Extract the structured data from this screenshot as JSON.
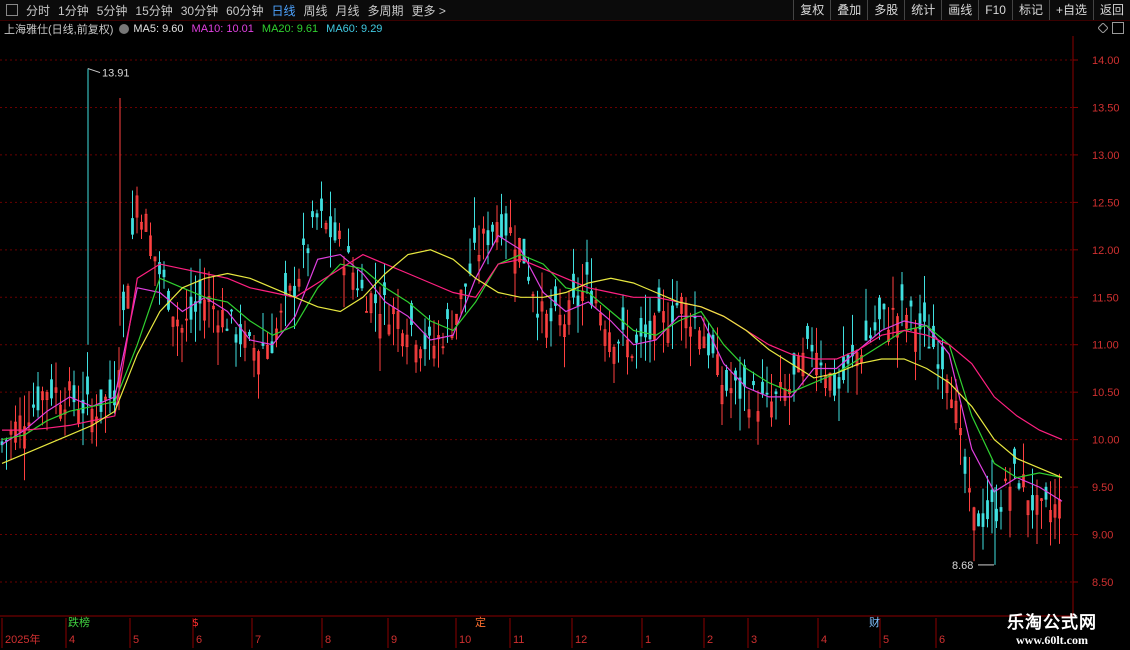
{
  "toolbar": {
    "periods": [
      "分时",
      "1分钟",
      "5分钟",
      "15分钟",
      "30分钟",
      "60分钟",
      "日线",
      "周线",
      "月线",
      "多周期",
      "更多 >"
    ],
    "active_period": "日线",
    "buttons": [
      "复权",
      "叠加",
      "多股",
      "统计",
      "画线",
      "F10",
      "标记",
      "+自选",
      "返回"
    ]
  },
  "info": {
    "stock": "上海雅仕(日线,前复权)",
    "ma": [
      {
        "label": "MA5: 9.60",
        "color": "#e0e0e0"
      },
      {
        "label": "MA10: 10.01",
        "color": "#e040e0"
      },
      {
        "label": "MA20: 9.61",
        "color": "#30d030"
      },
      {
        "label": "MA60: 9.29",
        "color": "#40c8e0"
      }
    ]
  },
  "chart_data": {
    "type": "candlestick",
    "ylim": [
      8.5,
      14.0
    ],
    "yticks": [
      "14.00",
      "13.50",
      "13.00",
      "12.50",
      "12.00",
      "11.50",
      "11.00",
      "10.50",
      "10.00",
      "9.50",
      "9.00",
      "8.50"
    ],
    "grid": true,
    "high_label": "13.91",
    "low_label": "8.68",
    "x_labels": [
      "2025年",
      "4",
      "5",
      "6",
      "7",
      "8",
      "9",
      "10",
      "11",
      "12",
      "1",
      "2",
      "3",
      "4",
      "5",
      "6"
    ],
    "events": [
      {
        "label": "跌榜",
        "color": "#40d040"
      },
      {
        "label": "$",
        "color": "#ff3030"
      },
      {
        "label": "定",
        "color": "#ff7030"
      },
      {
        "label": "财",
        "color": "#80c0ff"
      }
    ],
    "series": [
      {
        "color": "#ffffff",
        "values": [
          9.95,
          10.25,
          10.55,
          10.45,
          10.3,
          10.5,
          12.6,
          11.75,
          11.15,
          11.5,
          11.25,
          10.95,
          11.05,
          11.65,
          12.35,
          12.05,
          11.55,
          11.4,
          11.25,
          10.95,
          11.25,
          11.95,
          12.35,
          12.05,
          11.25,
          11.25,
          11.65,
          11.15,
          10.95,
          11.15,
          11.45,
          11.2,
          10.55,
          10.5,
          10.35,
          10.55,
          11.05,
          10.5,
          10.95,
          11.25,
          11.35,
          11.1,
          10.75,
          9.15,
          9.25,
          9.65,
          9.2,
          9.3
        ]
      },
      {
        "color": "#e040e0",
        "values": [
          9.95,
          10.1,
          10.3,
          10.45,
          10.35,
          10.45,
          11.6,
          11.55,
          11.35,
          11.5,
          11.35,
          11.05,
          11.0,
          11.3,
          11.9,
          11.95,
          11.75,
          11.45,
          11.3,
          11.05,
          11.1,
          11.7,
          12.15,
          12.0,
          11.55,
          11.35,
          11.45,
          11.25,
          11.0,
          11.05,
          11.3,
          11.3,
          10.8,
          10.55,
          10.45,
          10.45,
          10.75,
          10.75,
          10.95,
          11.15,
          11.25,
          11.2,
          10.9,
          9.9,
          9.45,
          9.6,
          9.5,
          9.35
        ]
      },
      {
        "color": "#30d030",
        "values": [
          10.0,
          10.05,
          10.2,
          10.3,
          10.35,
          10.4,
          11.0,
          11.7,
          11.6,
          11.5,
          11.45,
          11.25,
          11.1,
          11.2,
          11.6,
          11.85,
          11.8,
          11.6,
          11.45,
          11.25,
          11.15,
          11.45,
          11.85,
          11.95,
          11.85,
          11.6,
          11.55,
          11.35,
          11.15,
          11.1,
          11.25,
          11.35,
          11.0,
          10.75,
          10.6,
          10.5,
          10.6,
          10.7,
          10.85,
          11.0,
          11.15,
          11.2,
          11.0,
          10.25,
          9.75,
          9.6,
          9.65,
          9.6
        ]
      },
      {
        "color": "#ff2080",
        "values": [
          10.1,
          10.1,
          10.12,
          10.15,
          10.2,
          10.25,
          11.7,
          11.85,
          11.8,
          11.75,
          11.7,
          11.6,
          11.55,
          11.5,
          11.65,
          11.8,
          11.95,
          11.85,
          11.75,
          11.65,
          11.55,
          11.5,
          11.85,
          11.9,
          11.8,
          11.7,
          11.6,
          11.55,
          11.5,
          11.5,
          11.45,
          11.4,
          11.3,
          11.15,
          11.0,
          10.9,
          10.85,
          10.85,
          10.95,
          11.1,
          11.15,
          11.1,
          11.0,
          10.8,
          10.45,
          10.25,
          10.1,
          10.0
        ]
      },
      {
        "color": "#e8e840",
        "values": [
          9.75,
          9.85,
          9.95,
          10.05,
          10.15,
          10.3,
          10.9,
          11.35,
          11.6,
          11.7,
          11.75,
          11.7,
          11.6,
          11.5,
          11.4,
          11.35,
          11.5,
          11.75,
          11.95,
          12.0,
          11.9,
          11.7,
          11.55,
          11.5,
          11.5,
          11.55,
          11.65,
          11.7,
          11.65,
          11.55,
          11.45,
          11.4,
          11.3,
          11.15,
          10.95,
          10.8,
          10.65,
          10.7,
          10.8,
          10.85,
          10.85,
          10.75,
          10.6,
          10.35,
          10.0,
          9.8,
          9.7,
          9.6
        ]
      }
    ]
  },
  "watermark": {
    "line1": "乐淘公式网",
    "line2": "www.60lt.com"
  }
}
